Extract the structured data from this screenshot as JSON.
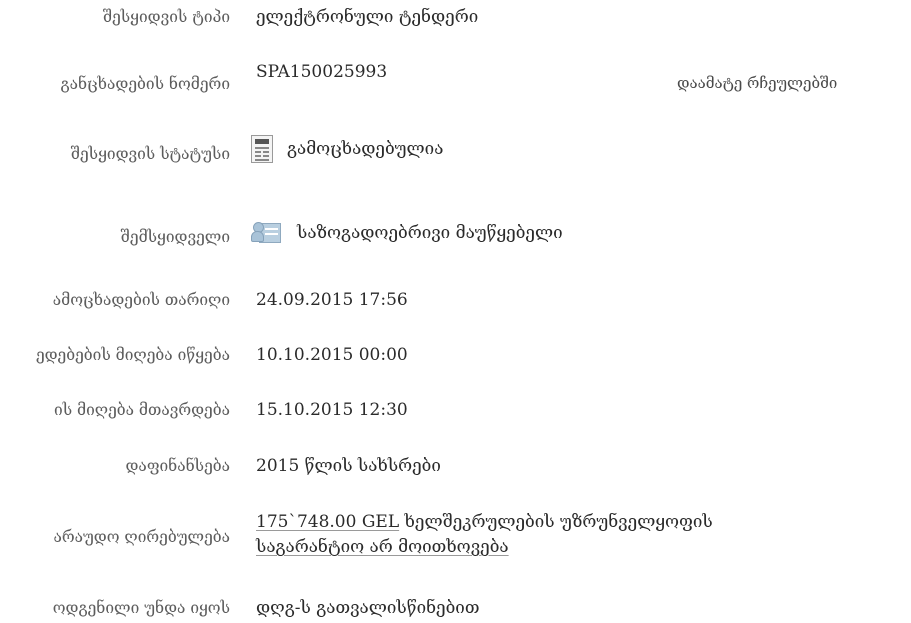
{
  "favorites_link": "დაამატე რჩეულებში",
  "rows": [
    {
      "label": "შესყიდვის ტიპი",
      "value": "ელექტრონული ტენდერი"
    },
    {
      "label": "განცხადების ნომერი",
      "value": "SPA150025993"
    },
    {
      "label": "შესყიდვის სტატუსი",
      "value": "გამოცხადებულია",
      "icon": "announcement-doc-icon"
    },
    {
      "label": "შემსყიდველი",
      "value": "საზოგადოებრივი მაუწყებელი",
      "icon": "person-card-icon"
    },
    {
      "label": "ამოცხადების თარიღი",
      "value": "24.09.2015 17:56"
    },
    {
      "label": "ედებების მიღება იწყება",
      "value": "10.10.2015 00:00"
    },
    {
      "label": "ის მიღება მთავრდება",
      "value": "15.10.2015 12:30"
    },
    {
      "label": "დაფინანსება",
      "value": "2015 წლის სახსრები"
    },
    {
      "label": "არაუდო ღირებულება",
      "amount": "175`748.00 GEL",
      "value_rest": "ხელშეკრულების უზრუნველყოფის",
      "value_line2": "საგარანტიო არ მოითხოვება"
    },
    {
      "label": "ოდგენილი უნდა იყოს",
      "value": "დღგ-ს გათვალისწინებით"
    }
  ]
}
